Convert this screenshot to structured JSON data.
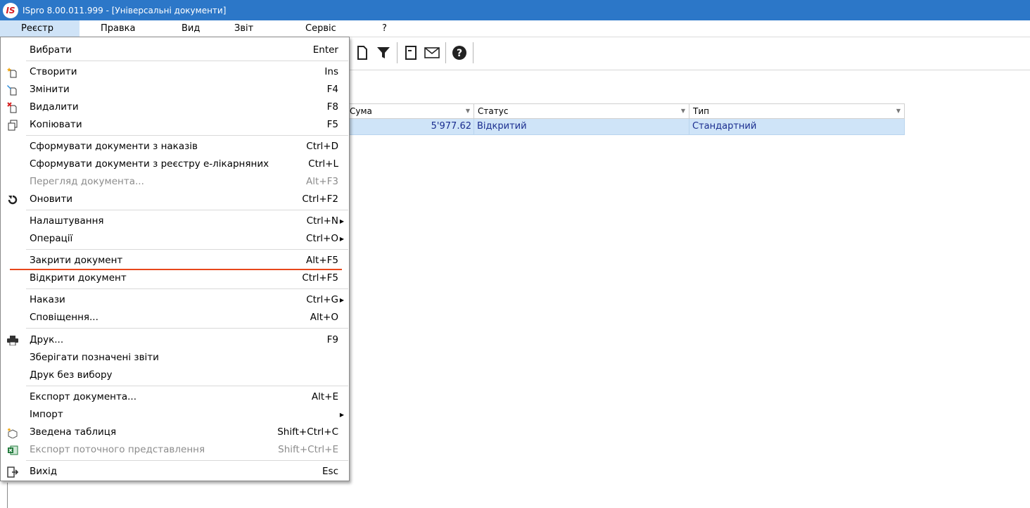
{
  "window": {
    "logo": "IS",
    "title": "ISpro 8.00.011.999 - [Універсальні документи]"
  },
  "menubar": [
    "Реєстр",
    "Правка",
    "Вид",
    "Звіт",
    "Сервіс",
    "?"
  ],
  "grid": {
    "columns": [
      "Сума",
      "Статус",
      "Тип"
    ],
    "rows": [
      {
        "sum": "5'977.62",
        "status": "Відкритий",
        "type": "Стандартний"
      }
    ]
  },
  "menu": [
    {
      "label": "Вибрати",
      "shortcut": "Enter",
      "icon": ""
    },
    {
      "label": "Створити",
      "shortcut": "Ins",
      "icon": "new-doc-icon"
    },
    {
      "label": "Змінити",
      "shortcut": "F4",
      "icon": "edit-doc-icon"
    },
    {
      "label": "Видалити",
      "shortcut": "F8",
      "icon": "delete-doc-icon"
    },
    {
      "label": "Копіювати",
      "shortcut": "F5",
      "icon": "copy-icon"
    },
    {
      "label": "Сформувати документи з наказів",
      "shortcut": "Ctrl+D",
      "icon": ""
    },
    {
      "label": "Сформувати документи з реєстру е-лікарняних",
      "shortcut": "Ctrl+L",
      "icon": ""
    },
    {
      "label": "Перегляд документа...",
      "shortcut": "Alt+F3",
      "icon": "",
      "disabled": true
    },
    {
      "label": "Оновити",
      "shortcut": "Ctrl+F2",
      "icon": "refresh-icon"
    },
    {
      "label": "Налаштування",
      "shortcut": "Ctrl+N",
      "icon": "",
      "submenu": true
    },
    {
      "label": "Операції",
      "shortcut": "Ctrl+O",
      "icon": "",
      "submenu": true
    },
    {
      "label": "Закрити документ",
      "shortcut": "Alt+F5",
      "icon": ""
    },
    {
      "label": "Відкрити документ",
      "shortcut": "Ctrl+F5",
      "icon": ""
    },
    {
      "label": "Накази",
      "shortcut": "Ctrl+G",
      "icon": "",
      "submenu": true
    },
    {
      "label": "Сповіщення...",
      "shortcut": "Alt+O",
      "icon": ""
    },
    {
      "label": "Друк...",
      "shortcut": "F9",
      "icon": "printer-icon"
    },
    {
      "label": "Зберігати позначені звіти",
      "shortcut": "",
      "icon": ""
    },
    {
      "label": "Друк без вибору",
      "shortcut": "",
      "icon": ""
    },
    {
      "label": "Експорт документа...",
      "shortcut": "Alt+E",
      "icon": ""
    },
    {
      "label": "Імпорт",
      "shortcut": "",
      "icon": "",
      "submenu": true
    },
    {
      "label": "Зведена таблиця",
      "shortcut": "Shift+Ctrl+C",
      "icon": "pivot-icon"
    },
    {
      "label": "Експорт поточного представлення",
      "shortcut": "Shift+Ctrl+E",
      "icon": "excel-icon",
      "disabled": true
    },
    {
      "label": "Вихід",
      "shortcut": "Esc",
      "icon": "exit-icon"
    }
  ]
}
